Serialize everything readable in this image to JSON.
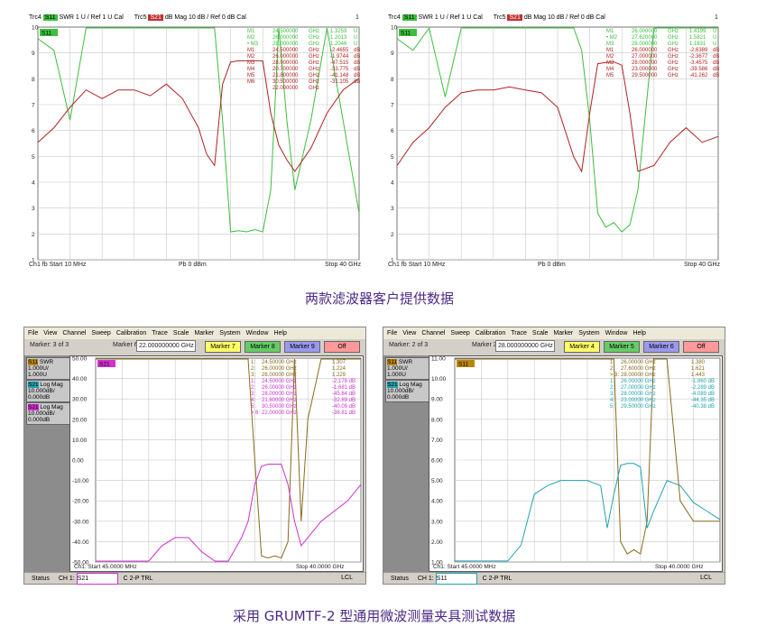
{
  "captions": {
    "top": "两款滤波器客户提供数据",
    "bottom": "采用 GRUMTF-2 型通用微波测量夹具测试数据"
  },
  "top_left": {
    "header": {
      "trc4": "Trc4",
      "s11": "S11",
      "swr": "SWR  1 U / Ref 1 U",
      "cal1": "Cal",
      "trc5": "Trc5",
      "s21": "S21",
      "dbmag": "dB Mag  10 dB / Ref 0 dB",
      "cal2": "Cal",
      "num": "1"
    },
    "tag": "S11",
    "footer": {
      "left": "Ch1  fb  Start  10 MHz",
      "mid": "Pb  0 dBm",
      "right": "Stop  40 GHz"
    },
    "yticks": [
      "10",
      "9",
      "8",
      "7",
      "6",
      "5",
      "4",
      "3",
      "2",
      "1"
    ],
    "markers": [
      [
        "M1",
        "24.500000",
        "GHz",
        "1.3259",
        "U"
      ],
      [
        "M2",
        "26.000000",
        "GHz",
        "1.2013",
        "U"
      ],
      [
        "• M3",
        "28.000000",
        "GHz",
        "1.2046",
        "U"
      ],
      [
        "M1",
        "24.500000",
        "GHz",
        "-2.4655",
        "dB"
      ],
      [
        "M2",
        "26.000000",
        "GHz",
        "-1.9744",
        "dB"
      ],
      [
        "M3",
        "28.000000",
        "GHz",
        "-47.515",
        "dB"
      ],
      [
        "M4",
        "20.700000",
        "GHz",
        "-33.775",
        "dB"
      ],
      [
        "M5",
        "21.800000",
        "GHz",
        "-41.148",
        "dB"
      ],
      [
        "M6",
        "30.500000",
        "GHz",
        "-31.105",
        "dB"
      ],
      [
        "",
        "22.000000",
        "GHz",
        "",
        ""
      ]
    ]
  },
  "top_right": {
    "header": {
      "trc4": "Trc4",
      "s11": "S11",
      "swr": "SWR  1 U / Ref 1 U",
      "cal1": "Cal",
      "trc5": "Trc5",
      "s21": "S21",
      "dbmag": "dB Mag  10 dB / Ref 0 dB",
      "cal2": "Cal",
      "num": "1"
    },
    "tag": "S11",
    "footer": {
      "left": "Ch1  fb  Start  10 MHz",
      "mid": "Pb  0 dBm",
      "right": "Stop  40 GHz"
    },
    "yticks": [
      "10",
      "9",
      "8",
      "7",
      "6",
      "5",
      "4",
      "3",
      "2",
      "1"
    ],
    "markers": [
      [
        "M1",
        "26.000000",
        "GHz",
        "1.4199",
        "U"
      ],
      [
        "• M2",
        "27.620000",
        "GHz",
        "1.5821",
        "U"
      ],
      [
        "M3",
        "28.000000",
        "GHz",
        "1.1831",
        "U"
      ],
      [
        "M1",
        "26.000000",
        "GHz",
        "-2.6389",
        "dB"
      ],
      [
        "M2",
        "27.000000",
        "GHz",
        "-2.3677",
        "dB"
      ],
      [
        "M3",
        "28.000000",
        "GHz",
        "-3.4575",
        "dB"
      ],
      [
        "M4",
        "23.000000",
        "GHz",
        "-39.586",
        "dB"
      ],
      [
        "M5",
        "29.500000",
        "GHz",
        "-41.262",
        "dB"
      ]
    ]
  },
  "bottom_left": {
    "menu": [
      "File",
      "View",
      "Channel",
      "Sweep",
      "Calibration",
      "Trace",
      "Scale",
      "Marker",
      "System",
      "Window",
      "Help"
    ],
    "marker_info": "Marker: 3 of 3",
    "marker_sel_label": "Marker 6",
    "marker_sel_value": "22.000000000 GHz",
    "buttons": [
      "Marker 7",
      "Marker 8",
      "Marker 9",
      "Off"
    ],
    "traces": [
      {
        "name": "S11",
        "fmt": "SWR",
        "l1": "1.000U/",
        "l2": "1.000U"
      },
      {
        "name": "S21",
        "fmt": "Log Mag",
        "l1": "10.000dB/",
        "l2": "0.000dB"
      },
      {
        "name": "S21",
        "fmt": "Log Mag",
        "l1": "10.000dB/",
        "l2": "0.000dB"
      }
    ],
    "tag": "S21",
    "yticks": [
      "50.00",
      "40.00",
      "30.00",
      "20.00",
      "10.00",
      "0.00",
      "-10.00",
      "-20.00",
      "-30.00",
      "-40.00",
      "-50.00"
    ],
    "footer": {
      "start": "Ch1: Start  45.0000 MHz",
      "stop": "Stop  40.0000 GHz"
    },
    "status": {
      "label": "Status",
      "ch": "CH 1:",
      "param": "S21",
      "cal": "C  2-P TRL",
      "lcl": "LCL"
    },
    "markers": [
      [
        "1:",
        "24.50000 GHz",
        "1.307"
      ],
      [
        "2:",
        "26.00000 GHz",
        "1.224"
      ],
      [
        "3:",
        "28.00000 GHz",
        "1.229"
      ],
      [
        "1:",
        "24.50000 GHz",
        "-2.178 dB"
      ],
      [
        "2:",
        "26.00000 GHz",
        "-1.681 dB"
      ],
      [
        "3:",
        "28.00000 GHz",
        "-45.84 dB"
      ],
      [
        "4:",
        "21.80000 GHz",
        "-32.89 dB"
      ],
      [
        "5:",
        "30.50000 GHz",
        "-40.09 dB"
      ],
      [
        "> 6:",
        "22.00000 GHz",
        "-38.81 dB"
      ]
    ]
  },
  "bottom_right": {
    "menu": [
      "File",
      "View",
      "Channel",
      "Sweep",
      "Calibration",
      "Trace",
      "Scale",
      "Marker",
      "System",
      "Window",
      "Help"
    ],
    "marker_info": "Marker: 2 of 3",
    "marker_sel_label": "Marker 3",
    "marker_sel_value": "28.000000000 GHz",
    "buttons": [
      "Marker 4",
      "Marker 5",
      "Marker 6",
      "Off"
    ],
    "traces": [
      {
        "name": "S11",
        "fmt": "SWR",
        "l1": "1.000U/",
        "l2": "1.000U"
      },
      {
        "name": "S21",
        "fmt": "Log Mag",
        "l1": "10.000dB/",
        "l2": "0.000dB"
      }
    ],
    "tag": "S11",
    "yticks": [
      "11.00",
      "10.00",
      "9.00",
      "8.00",
      "7.00",
      "6.00",
      "5.00",
      "4.00",
      "3.00",
      "2.00",
      "1.00"
    ],
    "footer": {
      "start": "Ch1: Start  45.0000 MHz",
      "stop": "Stop  40.0000 GHz"
    },
    "status": {
      "label": "Status",
      "ch": "CH 1:",
      "param": "S11",
      "cal": "C  2-P TRL",
      "lcl": "LCL"
    },
    "markers": [
      [
        "1:",
        "26.00000 GHz",
        "1.380"
      ],
      [
        "2:",
        "27.60000 GHz",
        "1.621"
      ],
      [
        "> 3:",
        "28.00000 GHz",
        "1.443"
      ],
      [
        "1:",
        "26.00000 GHz",
        "-1.860 dB"
      ],
      [
        "2:",
        "27.00000 GHz",
        "-2.289 dB"
      ],
      [
        "3:",
        "28.00000 GHz",
        "-4.089 dB"
      ],
      [
        "4:",
        "23.00000 GHz",
        "-44.35 dB"
      ],
      [
        "5:",
        "29.50000 GHz",
        "-40.38 dB"
      ]
    ]
  },
  "colors": {
    "s11_green": "#3cbf3c",
    "s21_red": "#b22222",
    "s11_olive": "#8a6a1a",
    "s21_teal": "#1fa3b0",
    "s21_magenta": "#d030d0",
    "caption": "#4b2a86"
  },
  "chart_data": [
    {
      "type": "line",
      "x": [
        0.01,
        2,
        4,
        6,
        8,
        10,
        12,
        14,
        16,
        18,
        20,
        21,
        22,
        23,
        24,
        25,
        26,
        27,
        28,
        29,
        30,
        31,
        32,
        34,
        36,
        38,
        40
      ],
      "series": [
        {
          "name": "S11",
          "values": [
            9.5,
            9,
            6,
            10,
            10,
            10,
            10,
            10,
            10,
            10,
            10,
            10,
            10,
            6,
            1.2,
            1.25,
            1.2,
            1.3,
            1.2,
            3,
            10,
            6,
            3,
            6,
            10,
            6,
            2
          ]
        },
        {
          "name": "S21",
          "values": [
            -30,
            -25,
            -18,
            -12,
            -15,
            -12,
            -12,
            -14,
            -10,
            -15,
            -25,
            -34,
            -38,
            -10,
            -2.4,
            -2,
            -2,
            -2,
            -2,
            -20,
            -31,
            -36,
            -40,
            -32,
            -20,
            -12,
            -8
          ]
        }
      ],
      "ylim": [
        0,
        10
      ]
    },
    {
      "type": "line",
      "x": [
        0.01,
        2,
        4,
        6,
        8,
        10,
        12,
        14,
        16,
        18,
        20,
        22,
        23,
        24,
        25,
        26,
        27,
        28,
        29,
        30,
        32,
        34,
        36,
        38,
        40
      ],
      "series": [
        {
          "name": "S11",
          "values": [
            9.5,
            9,
            10,
            7,
            10,
            10,
            10,
            10,
            10,
            10,
            10,
            10,
            9,
            6,
            2,
            1.4,
            1.6,
            1.2,
            1.5,
            3,
            10,
            10,
            10,
            10,
            10
          ]
        },
        {
          "name": "S21",
          "values": [
            -38,
            -30,
            -25,
            -18,
            -13,
            -12,
            -12,
            -11,
            -12,
            -13,
            -18,
            -35,
            -40,
            -20,
            -3,
            -2.6,
            -2.4,
            -3.5,
            -20,
            -40,
            -38,
            -30,
            -25,
            -30,
            -28
          ]
        }
      ],
      "ylim": [
        0,
        10
      ]
    },
    {
      "type": "line",
      "x": [
        0.045,
        2,
        4,
        6,
        8,
        10,
        12,
        14,
        16,
        18,
        20,
        22,
        23,
        24,
        25,
        26,
        27,
        28,
        29,
        30,
        31,
        32,
        34,
        36,
        38,
        40
      ],
      "series": [
        {
          "name": "S11",
          "values": [
            11,
            11,
            11,
            11,
            11,
            11,
            11,
            11,
            11,
            11,
            11,
            11,
            11,
            6,
            1.3,
            1.2,
            1.3,
            1.2,
            2,
            11,
            3,
            8,
            11,
            11,
            11,
            11
          ]
        },
        {
          "name": "S21",
          "values": [
            -60,
            -60,
            -60,
            -60,
            -60,
            -42,
            -38,
            -38,
            -45,
            -60,
            -60,
            -38,
            -30,
            -12,
            -3,
            -2,
            -2,
            -2,
            -12,
            -30,
            -42,
            -38,
            -30,
            -25,
            -20,
            -12
          ]
        }
      ],
      "ylim": [
        -50,
        50
      ]
    },
    {
      "type": "line",
      "x": [
        0.045,
        2,
        4,
        6,
        8,
        10,
        12,
        14,
        16,
        18,
        20,
        22,
        23,
        24,
        25,
        26,
        27,
        28,
        29,
        30,
        32,
        34,
        36,
        38,
        40
      ],
      "series": [
        {
          "name": "S11",
          "values": [
            11,
            11,
            11,
            11,
            11,
            11,
            11,
            11,
            11,
            11,
            11,
            11,
            11,
            11,
            2,
            1.4,
            1.6,
            1.4,
            3,
            11,
            11,
            4,
            3,
            3,
            3
          ]
        },
        {
          "name": "S21",
          "values": [
            -60,
            -60,
            -60,
            -60,
            -60,
            -50,
            -20,
            -15,
            -12,
            -12,
            -12,
            -15,
            -40,
            -20,
            -3,
            -2,
            -2,
            -4,
            -40,
            -30,
            -12,
            -15,
            -25,
            -30,
            -35
          ]
        }
      ],
      "ylim": [
        1,
        11
      ]
    }
  ]
}
